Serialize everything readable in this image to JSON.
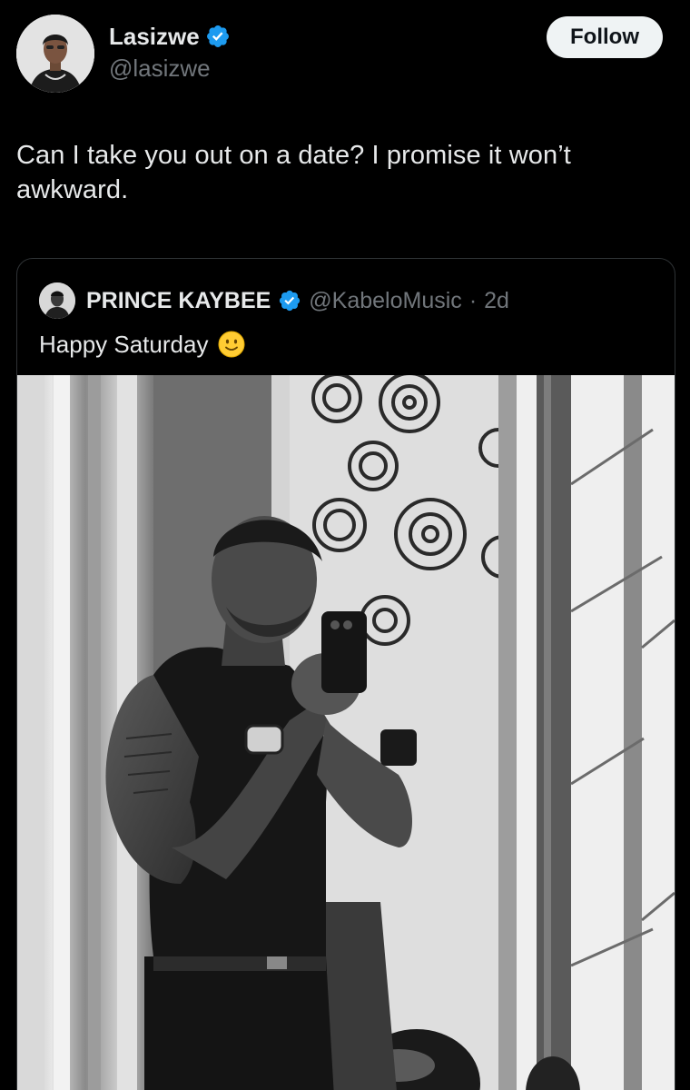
{
  "tweet": {
    "author": {
      "display_name": "Lasizwe",
      "handle": "@lasizwe",
      "verified": true,
      "avatar_icon": "profile-photo"
    },
    "follow_label": "Follow",
    "text": "Can I take you out on a date? I promise it won’t awkward."
  },
  "quoted": {
    "author": {
      "display_name": "PRINCE KAYBEE",
      "handle": "@KabeloMusic",
      "verified": true
    },
    "separator": "·",
    "time": "2d",
    "text": "Happy Saturday",
    "emoji_icon": "slightly-smiling-face-icon",
    "photo_icon": "mirror-selfie-photo"
  },
  "colors": {
    "background": "#000000",
    "text_primary": "#e7e9ea",
    "text_secondary": "#71767b",
    "verified_blue": "#1d9bf0",
    "follow_bg": "#eff3f4",
    "border": "#2f3336"
  }
}
